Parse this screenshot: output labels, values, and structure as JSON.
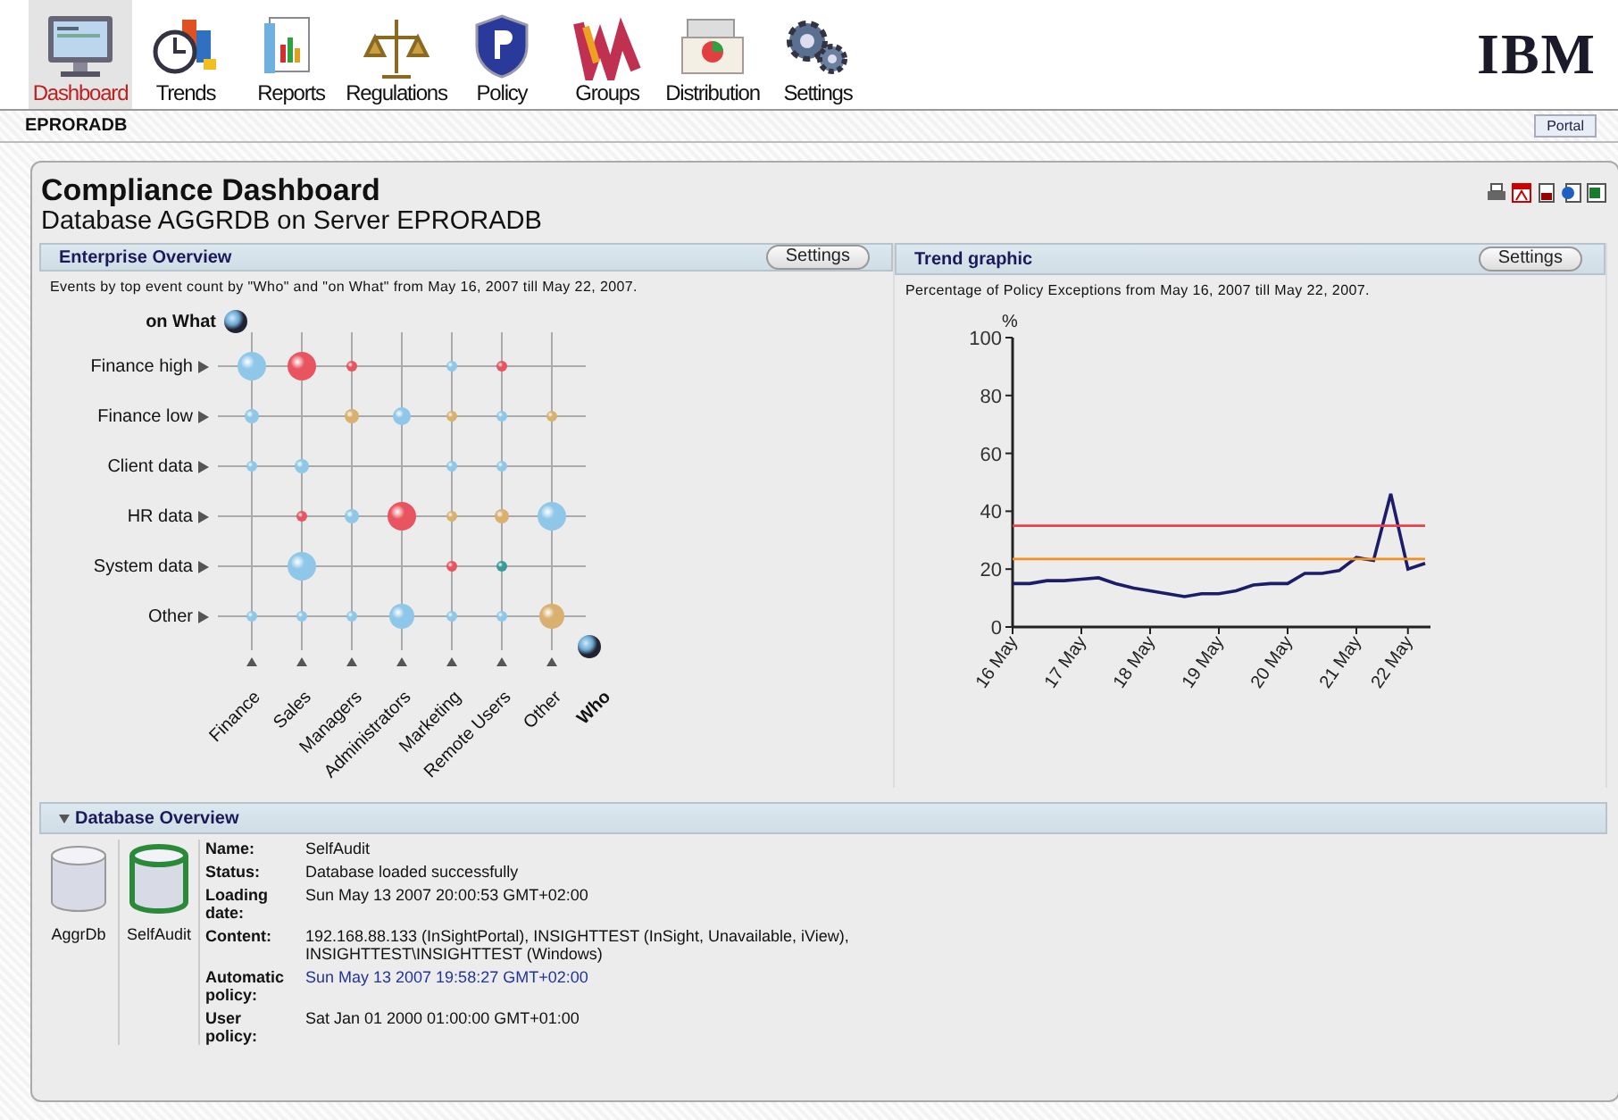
{
  "toolbar": {
    "items": [
      {
        "label": "Dashboard",
        "selected": true
      },
      {
        "label": "Trends",
        "selected": false
      },
      {
        "label": "Reports",
        "selected": false
      },
      {
        "label": "Regulations",
        "selected": false
      },
      {
        "label": "Policy",
        "selected": false
      },
      {
        "label": "Groups",
        "selected": false
      },
      {
        "label": "Distribution",
        "selected": false
      },
      {
        "label": "Settings",
        "selected": false
      }
    ],
    "logo": "IBM"
  },
  "breadcrumb": {
    "path": "EPRORADB",
    "tab": "Portal"
  },
  "page": {
    "title": "Compliance Dashboard",
    "subtitle": "Database AGGRDB on Server EPRORADB"
  },
  "enterprise_overview": {
    "title": "Enterprise Overview",
    "button": "Settings",
    "description": "Events by top event count by \"Who\" and \"on What\" from May 16, 2007 till May 22, 2007.",
    "y_axis_title": "on What",
    "rows": [
      "Finance high",
      "Finance low",
      "Client data",
      "HR data",
      "System data",
      "Other"
    ],
    "x_axis_title": "Who",
    "columns": [
      "Finance",
      "Sales",
      "Managers",
      "Administrators",
      "Marketing",
      "Remote Users",
      "Other"
    ]
  },
  "trend_graphic": {
    "title": "Trend graphic",
    "button": "Settings",
    "description": "Percentage of Policy Exceptions from May 16, 2007 till May 22, 2007.",
    "chart_data": {
      "type": "line",
      "ylabel": "%",
      "ylim": [
        0,
        100
      ],
      "yticks": [
        0,
        20,
        40,
        60,
        80,
        100
      ],
      "categories": [
        "16 May",
        null,
        null,
        null,
        "17 May",
        null,
        null,
        null,
        "18 May",
        null,
        null,
        null,
        "19 May",
        null,
        null,
        null,
        "20 May",
        null,
        null,
        null,
        "21 May",
        null,
        null,
        "22 May",
        null
      ],
      "series": [
        {
          "color": "#1c1c6b",
          "values": [
            15,
            15,
            16,
            16,
            16.5,
            17,
            15,
            13.5,
            12.5,
            11.5,
            10.5,
            11.5,
            11.5,
            12.5,
            14.5,
            15,
            15,
            18.5,
            18.5,
            19.5,
            24,
            23,
            46,
            20,
            22
          ]
        },
        {
          "color": "#e8404c",
          "values": [
            35,
            35,
            35,
            35,
            35,
            35,
            35,
            35,
            35,
            35,
            35,
            35,
            35,
            35,
            35,
            35,
            35,
            35,
            35,
            35,
            35,
            35,
            35,
            35,
            35
          ]
        },
        {
          "color": "#f09020",
          "values": [
            23.5,
            23.5,
            23.5,
            23.5,
            23.5,
            23.5,
            23.5,
            23.5,
            23.5,
            23.5,
            23.5,
            23.5,
            23.5,
            23.5,
            23.5,
            23.5,
            23.5,
            23.5,
            23.5,
            23.5,
            23.5,
            23.5,
            23.5,
            23.5,
            23.5
          ]
        }
      ]
    }
  },
  "database_overview": {
    "title": "Database Overview",
    "expanded": true,
    "databases": [
      {
        "label": "AggrDb",
        "selected": false
      },
      {
        "label": "SelfAudit",
        "selected": true
      }
    ],
    "details": [
      {
        "label": "Name:",
        "value": "SelfAudit",
        "kind": "text"
      },
      {
        "label": "Status:",
        "value": "Database loaded successfully",
        "kind": "text"
      },
      {
        "label": "Loading date:",
        "value": "Sun May 13 2007 20:00:53 GMT+02:00",
        "kind": "text"
      },
      {
        "label": "Content:",
        "value": "192.168.88.133 (InSightPortal), INSIGHTTEST (InSight, Unavailable, iView), INSIGHTTEST\\INSIGHTTEST (Windows)",
        "kind": "text"
      },
      {
        "label": "Automatic policy:",
        "value": "Sun May 13 2007 19:58:27 GMT+02:00",
        "kind": "link"
      },
      {
        "label": "User policy:",
        "value": "Sat Jan 01 2000 01:00:00 GMT+01:00",
        "kind": "text"
      }
    ]
  }
}
